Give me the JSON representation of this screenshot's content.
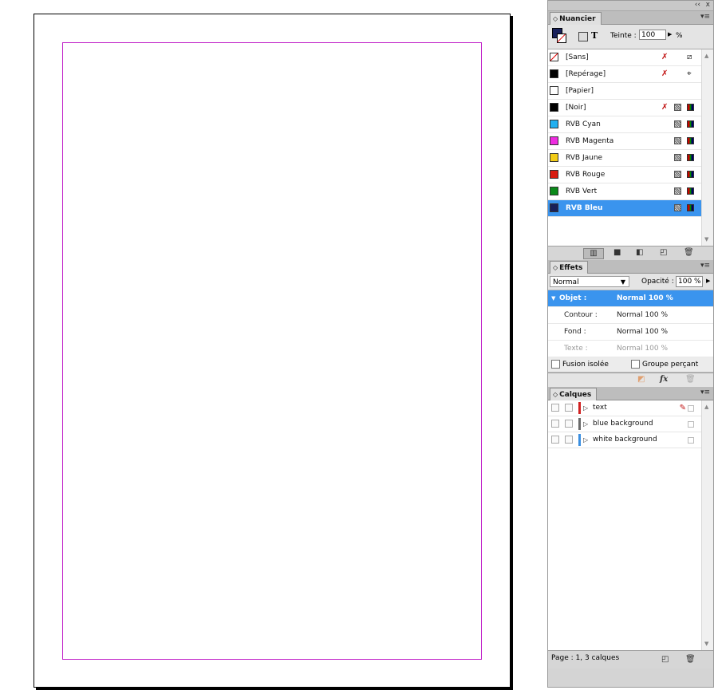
{
  "panels_topbar": {
    "collapse": "‹‹",
    "close": "x"
  },
  "swatches": {
    "tab": "Nuancier",
    "tint_label": "Teinte :",
    "tint_value": "100",
    "tint_unit": "%",
    "rows": [
      {
        "name": "[Sans]",
        "color": "#ffffff",
        "none": true
      },
      {
        "name": "[Repérage]",
        "color": "#000000"
      },
      {
        "name": "[Papier]",
        "color": "#ffffff"
      },
      {
        "name": "[Noir]",
        "color": "#000000"
      },
      {
        "name": "RVB Cyan",
        "color": "#22b0f0"
      },
      {
        "name": "RVB Magenta",
        "color": "#ee2ce0"
      },
      {
        "name": "RVB Jaune",
        "color": "#f2cc18"
      },
      {
        "name": "RVB Rouge",
        "color": "#d81c10"
      },
      {
        "name": "RVB Vert",
        "color": "#0a8a1a"
      },
      {
        "name": "RVB Bleu",
        "color": "#18205a",
        "selected": true
      }
    ]
  },
  "effects": {
    "tab": "Effets",
    "blend_mode": "Normal",
    "opacity_label": "Opacité :",
    "opacity_value": "100 %",
    "rows": [
      {
        "key": "Objet :",
        "value": "Normal 100 %"
      },
      {
        "key": "Contour :",
        "value": "Normal 100 %"
      },
      {
        "key": "Fond :",
        "value": "Normal 100 %"
      },
      {
        "key": "Texte :",
        "value": "Normal 100 %"
      }
    ],
    "isolate_label": "Fusion isolée",
    "knockout_label": "Groupe perçant",
    "fx_label": "fx"
  },
  "layers": {
    "tab": "Calques",
    "items": [
      {
        "name": "text",
        "color": "#d02020"
      },
      {
        "name": "blue background",
        "color": "#6a6a6a"
      },
      {
        "name": "white background",
        "color": "#3a8ee0"
      }
    ],
    "status": "Page : 1, 3 calques"
  }
}
